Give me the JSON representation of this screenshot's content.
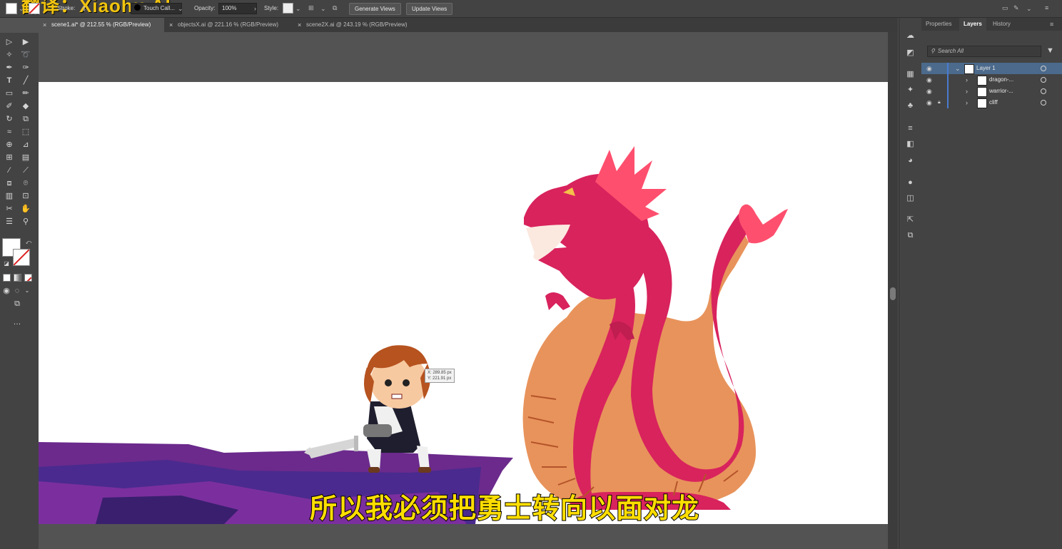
{
  "watermark": "翻译：Xiaohu.AI",
  "controlbar": {
    "stroke_label": "Stroke:",
    "brush_value": "Touch Call...",
    "opacity_label": "Opacity:",
    "opacity_value": "100%",
    "style_label": "Style:",
    "generate_views": "Generate Views",
    "update_views": "Update Views"
  },
  "tabs": [
    {
      "label": "scene1.ai* @ 212.55 % (RGB/Preview)",
      "active": true
    },
    {
      "label": "objectsX.ai @ 221.16 % (RGB/Preview)",
      "active": false
    },
    {
      "label": "scene2X.ai @ 243.19 % (RGB/Preview)",
      "active": false
    }
  ],
  "canvas": {
    "tooltip": [
      "X: 289.85 px",
      "Y: 221.91 px"
    ],
    "subtitle": "所以我必须把勇士转向以面对龙"
  },
  "panel": {
    "tabs": [
      "Properties",
      "Layers",
      "History"
    ],
    "active_tab": "Layers",
    "search_placeholder": "Search All",
    "layers": [
      {
        "name": "Layer 1",
        "selected": true
      },
      {
        "name": "dragon-...",
        "selected": false
      },
      {
        "name": "warrior-...",
        "selected": false
      },
      {
        "name": "cliff",
        "selected": false,
        "locked": true
      }
    ]
  },
  "colors": {
    "accent": "#4b6a8c",
    "dragon": "#d8235d",
    "dragon_belly": "#e8935b",
    "cliff": "#6b2a8c",
    "subtitle": "#ffde00"
  }
}
